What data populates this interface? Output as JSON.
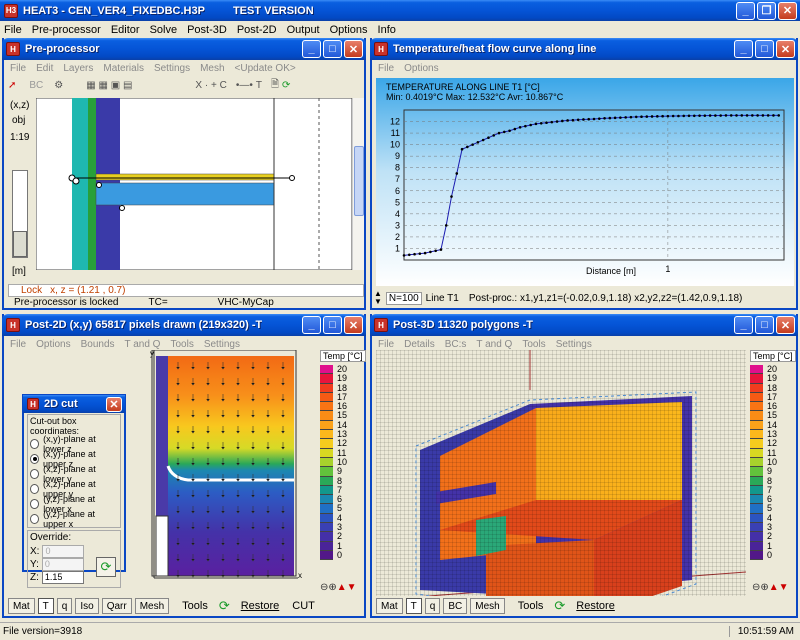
{
  "app": {
    "title": "HEAT3 - CEN_VER4_FIXEDBC.H3P",
    "version_tag": "TEST VERSION"
  },
  "menu": [
    "File",
    "Pre-processor",
    "Editor",
    "Solve",
    "Post-3D",
    "Post-2D",
    "Output",
    "Options",
    "Info"
  ],
  "pre": {
    "title": "Pre-processor",
    "menu": [
      "File",
      "Edit",
      "Layers",
      "Materials",
      "Settings",
      "Mesh",
      "<Update OK>"
    ],
    "bc": "BC",
    "xz": "(x,z)",
    "obj": "obj",
    "scale": "1:19",
    "unit": "[m]",
    "lock": "Lock",
    "coords": "x, z = (1.21 , 0.7)",
    "status_locked": "Pre-processor is locked",
    "tc": "TC=",
    "vhc": "VHC-MyCap",
    "toolbar_xc": "X · + C",
    "toolbar_t": "T"
  },
  "curve": {
    "title": "Temperature/heat flow curve along line",
    "menu": [
      "File",
      "Options"
    ],
    "nval": "N=100",
    "line": "Line T1",
    "postproc": "Post-proc.: x1,y1,z1=(-0.02,0.9,1.18)   x2,y2,z2=(1.42,0.9,1.18)"
  },
  "chart_data": {
    "type": "line",
    "title": "TEMPERATURE ALONG LINE T1 [°C]",
    "subtitle": "Min: 0.4019°C   Max: 12.532°C   Avr: 10.867°C",
    "xlabel": "Distance [m]",
    "ylabel": "",
    "xlim": [
      0,
      1.44
    ],
    "ylim": [
      0,
      13
    ],
    "yticks": [
      1,
      2,
      3,
      4,
      5,
      6,
      7,
      8,
      9,
      10,
      11,
      12
    ],
    "xticks": [
      1
    ],
    "grid": "horizontal-dashed",
    "x": [
      0,
      0.02,
      0.04,
      0.06,
      0.08,
      0.1,
      0.12,
      0.14,
      0.16,
      0.18,
      0.2,
      0.22,
      0.24,
      0.26,
      0.28,
      0.3,
      0.32,
      0.34,
      0.36,
      0.38,
      0.4,
      0.42,
      0.44,
      0.46,
      0.48,
      0.5,
      0.52,
      0.54,
      0.56,
      0.58,
      0.6,
      0.62,
      0.64,
      0.66,
      0.68,
      0.7,
      0.72,
      0.74,
      0.76,
      0.78,
      0.8,
      0.82,
      0.84,
      0.86,
      0.88,
      0.9,
      0.92,
      0.94,
      0.96,
      0.98,
      1.0,
      1.02,
      1.04,
      1.06,
      1.08,
      1.1,
      1.12,
      1.14,
      1.16,
      1.18,
      1.2,
      1.22,
      1.24,
      1.26,
      1.28,
      1.3,
      1.32,
      1.34,
      1.36,
      1.38,
      1.4,
      1.42
    ],
    "y": [
      0.4,
      0.45,
      0.5,
      0.55,
      0.6,
      0.7,
      0.8,
      0.9,
      3,
      5.5,
      7.5,
      9.6,
      9.8,
      10.0,
      10.2,
      10.4,
      10.6,
      10.8,
      11.0,
      11.1,
      11.2,
      11.35,
      11.5,
      11.6,
      11.7,
      11.8,
      11.85,
      11.9,
      11.95,
      12.0,
      12.05,
      12.1,
      12.12,
      12.15,
      12.18,
      12.2,
      12.22,
      12.25,
      12.28,
      12.3,
      12.32,
      12.34,
      12.36,
      12.38,
      12.4,
      12.42,
      12.43,
      12.44,
      12.45,
      12.46,
      12.47,
      12.48,
      12.48,
      12.49,
      12.5,
      12.5,
      12.51,
      12.51,
      12.52,
      12.52,
      12.52,
      12.53,
      12.53,
      12.53,
      12.53,
      12.53,
      12.53,
      12.53,
      12.53,
      12.53,
      12.53,
      12.53
    ]
  },
  "post2d": {
    "title": "Post-2D (x,y) 65817 pixels drawn (219x320) -T",
    "menu": [
      "File",
      "Options",
      "Bounds",
      "T and Q",
      "Tools",
      "Settings"
    ],
    "temp_label": "Temp [°C]",
    "axis_y": "y",
    "axis_x": "x",
    "tabs": [
      "Mat",
      "T",
      "q",
      "Iso",
      "Qarr",
      "Mesh"
    ],
    "tools": "Tools",
    "restore": "Restore",
    "cut": "CUT"
  },
  "cut": {
    "title": "2D cut",
    "group": "Cut-out box coordinates:",
    "options": [
      "(x,y)-plane at lower z",
      "(x,y)-plane at upper z",
      "(x,z)-plane at lower y",
      "(x,z)-plane at upper y",
      "(y,z)-plane at lower x",
      "(y,z)-plane at upper x"
    ],
    "selected": 1,
    "override": "Override:",
    "x": "X:",
    "y": "Y:",
    "z": "Z:",
    "zval": "1.15",
    "xval": "0",
    "yval": "0"
  },
  "post3d": {
    "title": "Post-3D 11320 polygons  -T",
    "menu": [
      "File",
      "Details",
      "BC:s",
      "T and Q",
      "Tools",
      "Settings"
    ],
    "temp_label": "Temp [°C]",
    "tabs": [
      "Mat",
      "T",
      "q",
      "BC",
      "Mesh"
    ],
    "tools": "Tools",
    "restore": "Restore"
  },
  "legend": [
    "20",
    "19",
    "18",
    "17",
    "16",
    "15",
    "14",
    "13",
    "12",
    "11",
    "10",
    "9",
    "8",
    "7",
    "6",
    "5",
    "4",
    "3",
    "2",
    "1",
    "0"
  ],
  "legend_colors": [
    "#e0108c",
    "#e8143c",
    "#f03c1e",
    "#f55a14",
    "#f87414",
    "#f98c16",
    "#fba21a",
    "#fbb81c",
    "#f5cc1e",
    "#d8d822",
    "#a8d22c",
    "#62c23c",
    "#2aa858",
    "#12988c",
    "#1a88b0",
    "#2070c4",
    "#2c54c0",
    "#3a40b4",
    "#4430a8",
    "#4a2498",
    "#521888"
  ],
  "taskbar": {
    "fileversion": "File version=3918",
    "time": "10:51:59 AM"
  }
}
